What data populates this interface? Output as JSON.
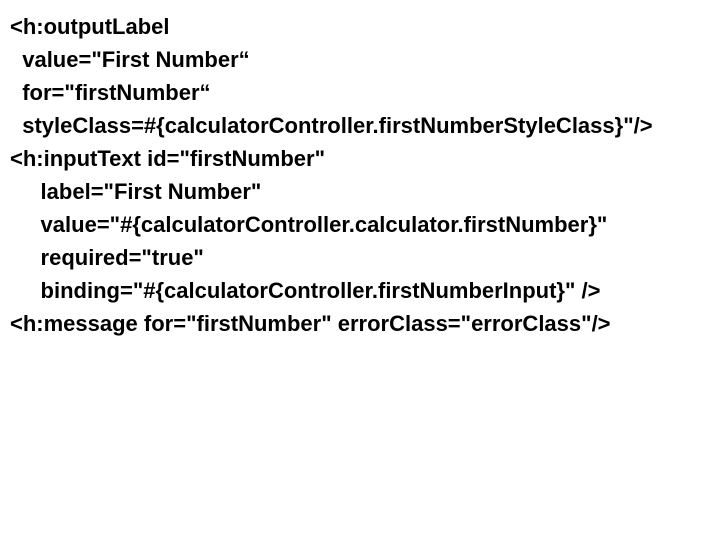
{
  "lines": {
    "l1": "<h:outputLabel",
    "l2": "  value=\"First Number“",
    "l3": "  for=\"firstNumber“",
    "l4": "  styleClass=#{calculatorController.firstNumberStyleClass}\"/>",
    "l5": "",
    "l6": "<h:inputText id=\"firstNumber\"",
    "l7": "     label=\"First Number\"",
    "l8": "     value=\"#{calculatorController.calculator.firstNumber}\"",
    "l9": "     required=\"true\"",
    "l10": "     binding=\"#{calculatorController.firstNumberInput}\" />",
    "l11": "",
    "l12": "<h:message for=\"firstNumber\" errorClass=\"errorClass\"/>"
  }
}
